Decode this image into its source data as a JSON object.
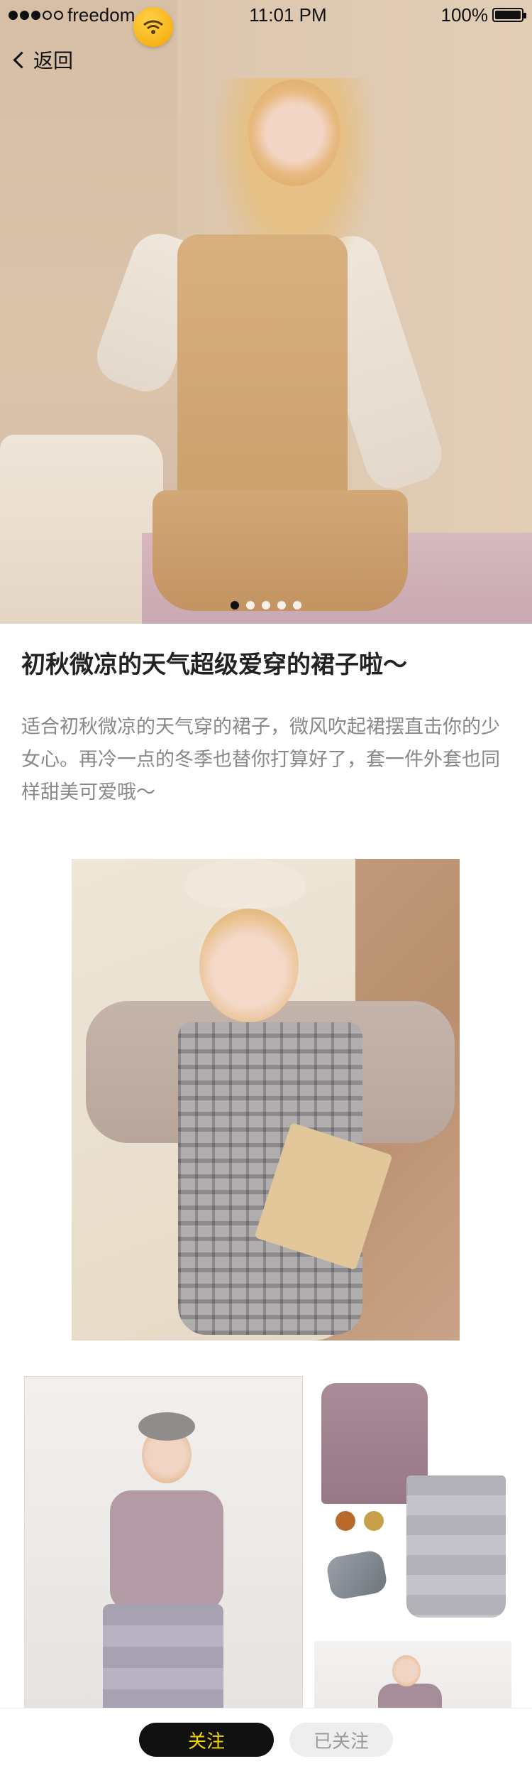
{
  "status_bar": {
    "carrier": "freedom",
    "time": "11:01 PM",
    "battery": "100%"
  },
  "nav": {
    "back_label": "返回"
  },
  "hero": {
    "pager_count": 5,
    "active_index": 0
  },
  "article": {
    "title": "初秋微凉的天气超级爱穿的裙子啦～",
    "description": "适合初秋微凉的天气穿的裙子，微风吹起裙摆直击你的少女心。再冷一点的冬季也替你打算好了，套一件外套也同样甜美可爱哦～"
  },
  "actions": {
    "follow_label": "关注",
    "followed_label": "已关注"
  },
  "colors": {
    "accent": "#f5d400",
    "button_dark": "#111111",
    "muted_text": "#888888"
  }
}
